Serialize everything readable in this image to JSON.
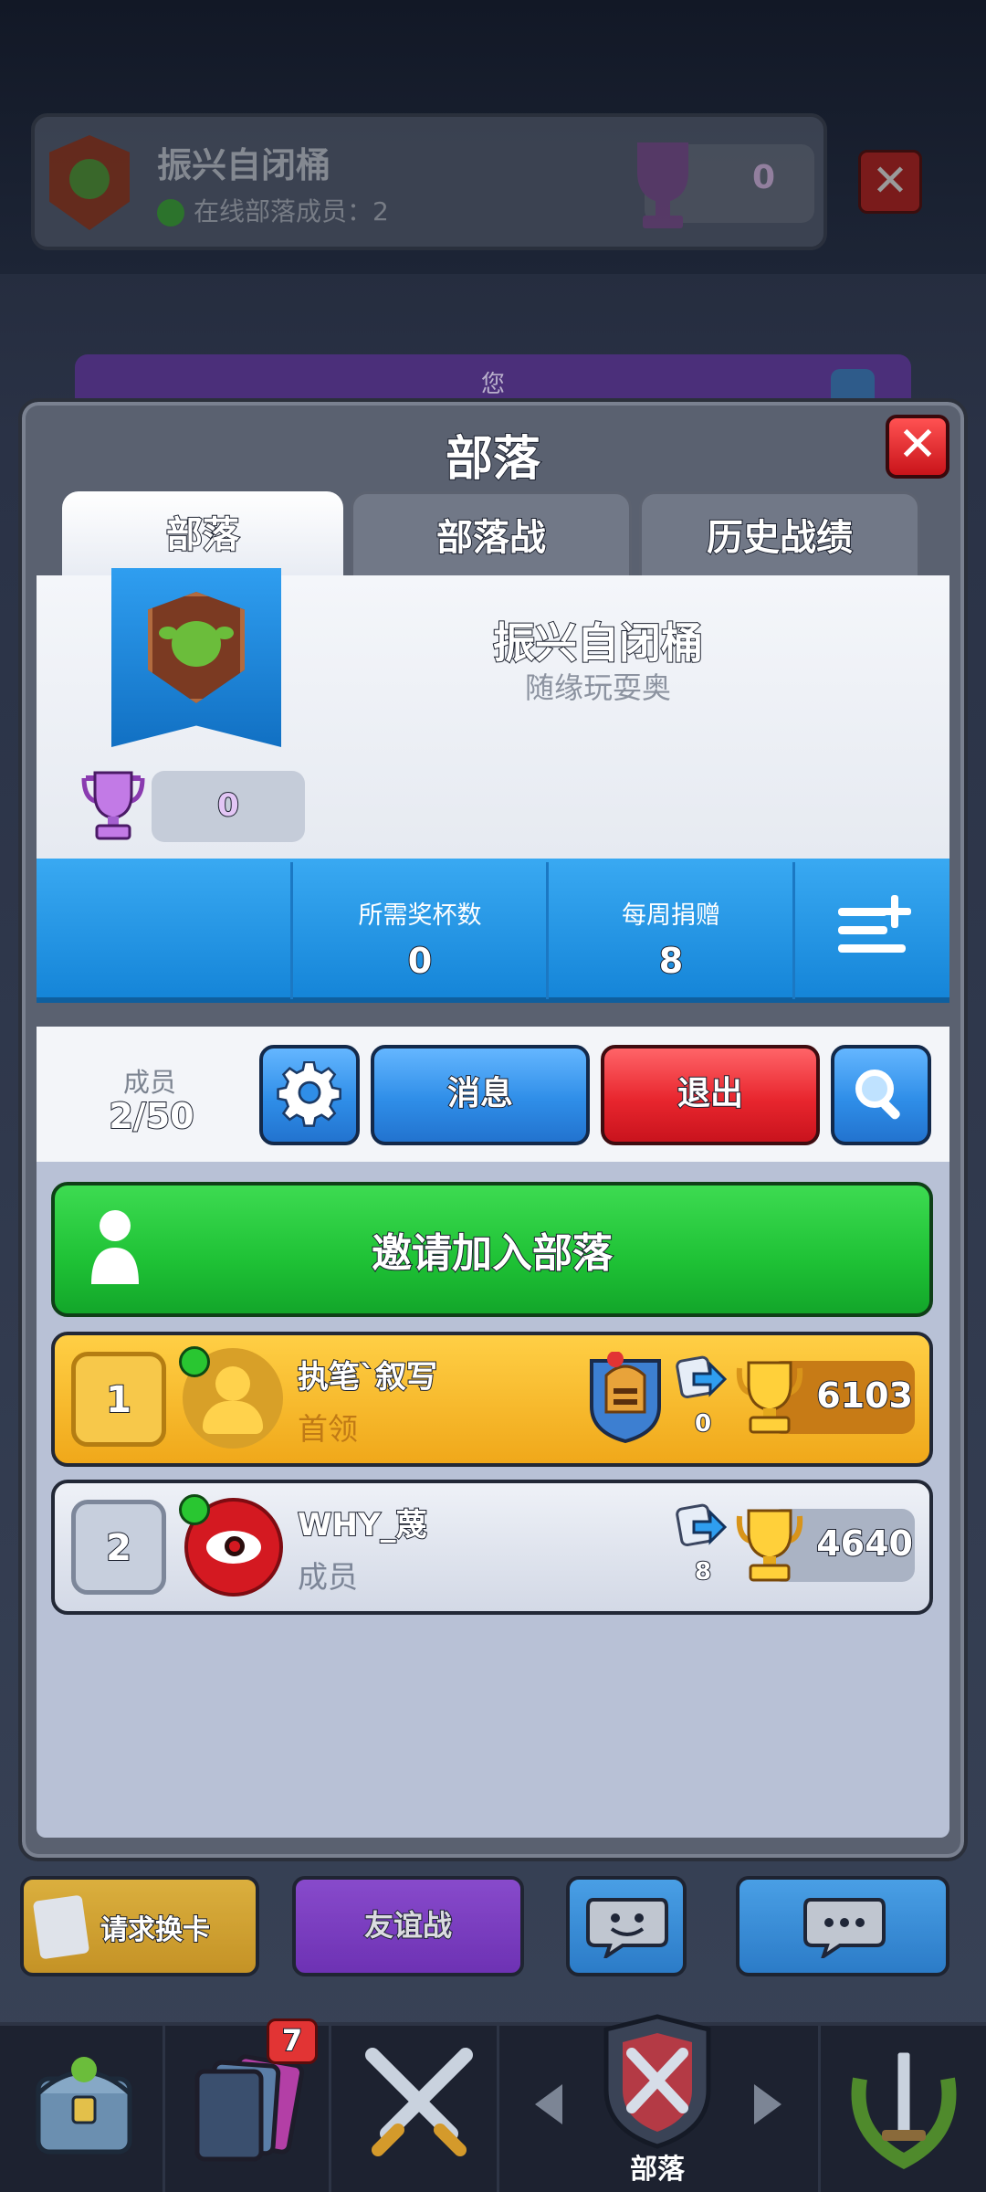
{
  "background": {
    "clan_name": "振兴自闭桶",
    "online_label": "在线部落成员：2",
    "trophies": "0",
    "you_label": "您"
  },
  "modal": {
    "title": "部落",
    "tabs": [
      {
        "label": "部落",
        "active": true
      },
      {
        "label": "部落战",
        "active": false
      },
      {
        "label": "历史战绩",
        "active": false
      }
    ]
  },
  "clan": {
    "name": "振兴自闭桶",
    "description": "随缘玩耍奥",
    "trophies": "0",
    "stats": {
      "required_trophies_label": "所需奖杯数",
      "required_trophies_value": "0",
      "weekly_donations_label": "每周捐赠",
      "weekly_donations_value": "8"
    }
  },
  "members_section": {
    "members_label": "成员",
    "members_count": "2/50",
    "message_button": "消息",
    "exit_button": "退出",
    "invite_button": "邀请加入部落"
  },
  "members": [
    {
      "rank": "1",
      "name": "执笔`叙写",
      "role": "首领",
      "donations": "0",
      "trophies": "6103",
      "online": true
    },
    {
      "rank": "2",
      "name": "WHY_蔑",
      "role": "成员",
      "donations": "8",
      "trophies": "4640",
      "online": true
    }
  ],
  "bottom_bar": {
    "request_card": "请求换卡",
    "friendly_battle": "友谊战"
  },
  "nav": {
    "cards_badge": "7",
    "active_label": "部落"
  },
  "colors": {
    "accent_blue": "#2f8ee8",
    "exit_red": "#e8262e",
    "invite_green": "#1ec135",
    "leader_gold": "#f0a81a",
    "online_green": "#29c631"
  }
}
